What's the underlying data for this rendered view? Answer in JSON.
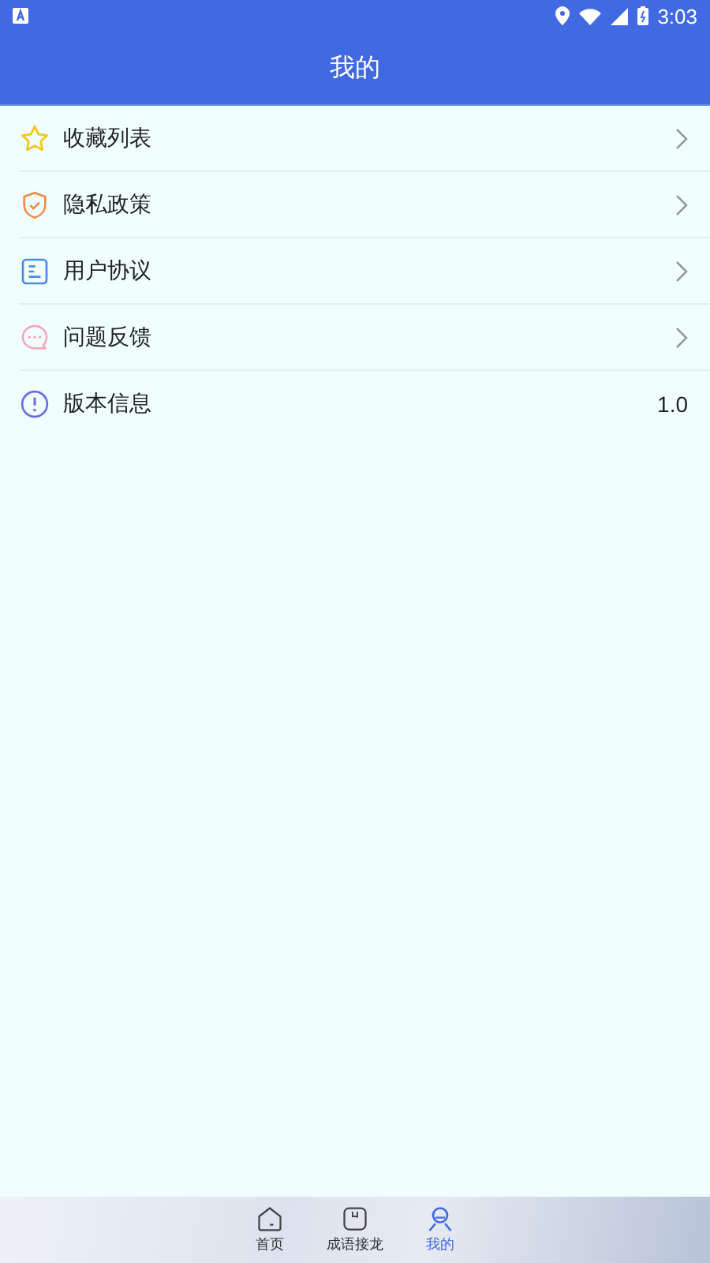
{
  "status_bar": {
    "time": "3:03"
  },
  "header": {
    "title": "我的"
  },
  "menu": [
    {
      "label": "收藏列表"
    },
    {
      "label": "隐私政策"
    },
    {
      "label": "用户协议"
    },
    {
      "label": "问题反馈"
    },
    {
      "label": "版本信息",
      "value": "1.0"
    }
  ],
  "tab_bar": [
    {
      "label": "首页",
      "selected": false
    },
    {
      "label": "成语接龙",
      "selected": false
    },
    {
      "label": "我的",
      "selected": true
    }
  ]
}
